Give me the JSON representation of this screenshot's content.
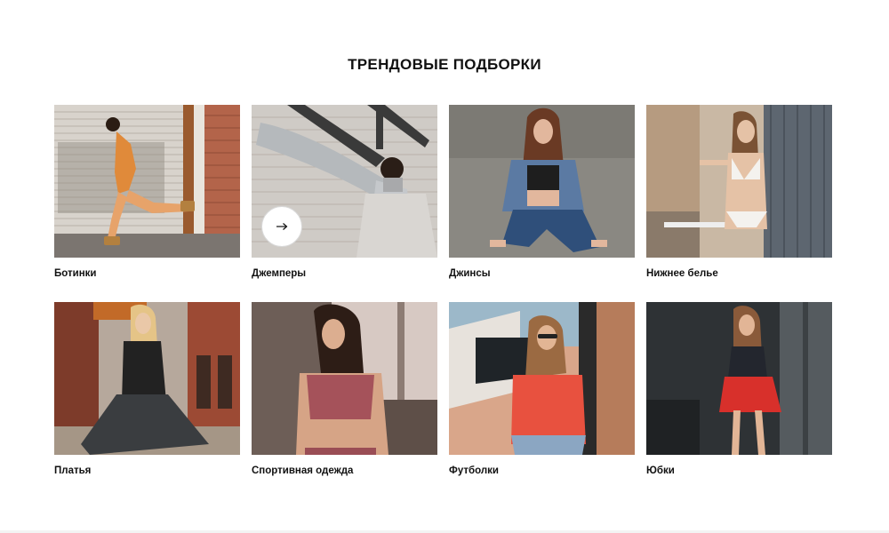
{
  "section": {
    "title": "ТРЕНДОВЫЕ ПОДБОРКИ"
  },
  "categories": [
    {
      "label": "Ботинки",
      "icon": "boots-photo"
    },
    {
      "label": "Джемперы",
      "icon": "jumper-photo",
      "has_arrow": true,
      "arrow_icon": "arrow-right-icon"
    },
    {
      "label": "Джинсы",
      "icon": "jeans-photo"
    },
    {
      "label": "Нижнее белье",
      "icon": "underwear-photo"
    },
    {
      "label": "Платья",
      "icon": "dress-photo"
    },
    {
      "label": "Спортивная одежда",
      "icon": "sportswear-photo"
    },
    {
      "label": "Футболки",
      "icon": "tshirt-photo"
    },
    {
      "label": "Юбки",
      "icon": "skirt-photo"
    }
  ]
}
